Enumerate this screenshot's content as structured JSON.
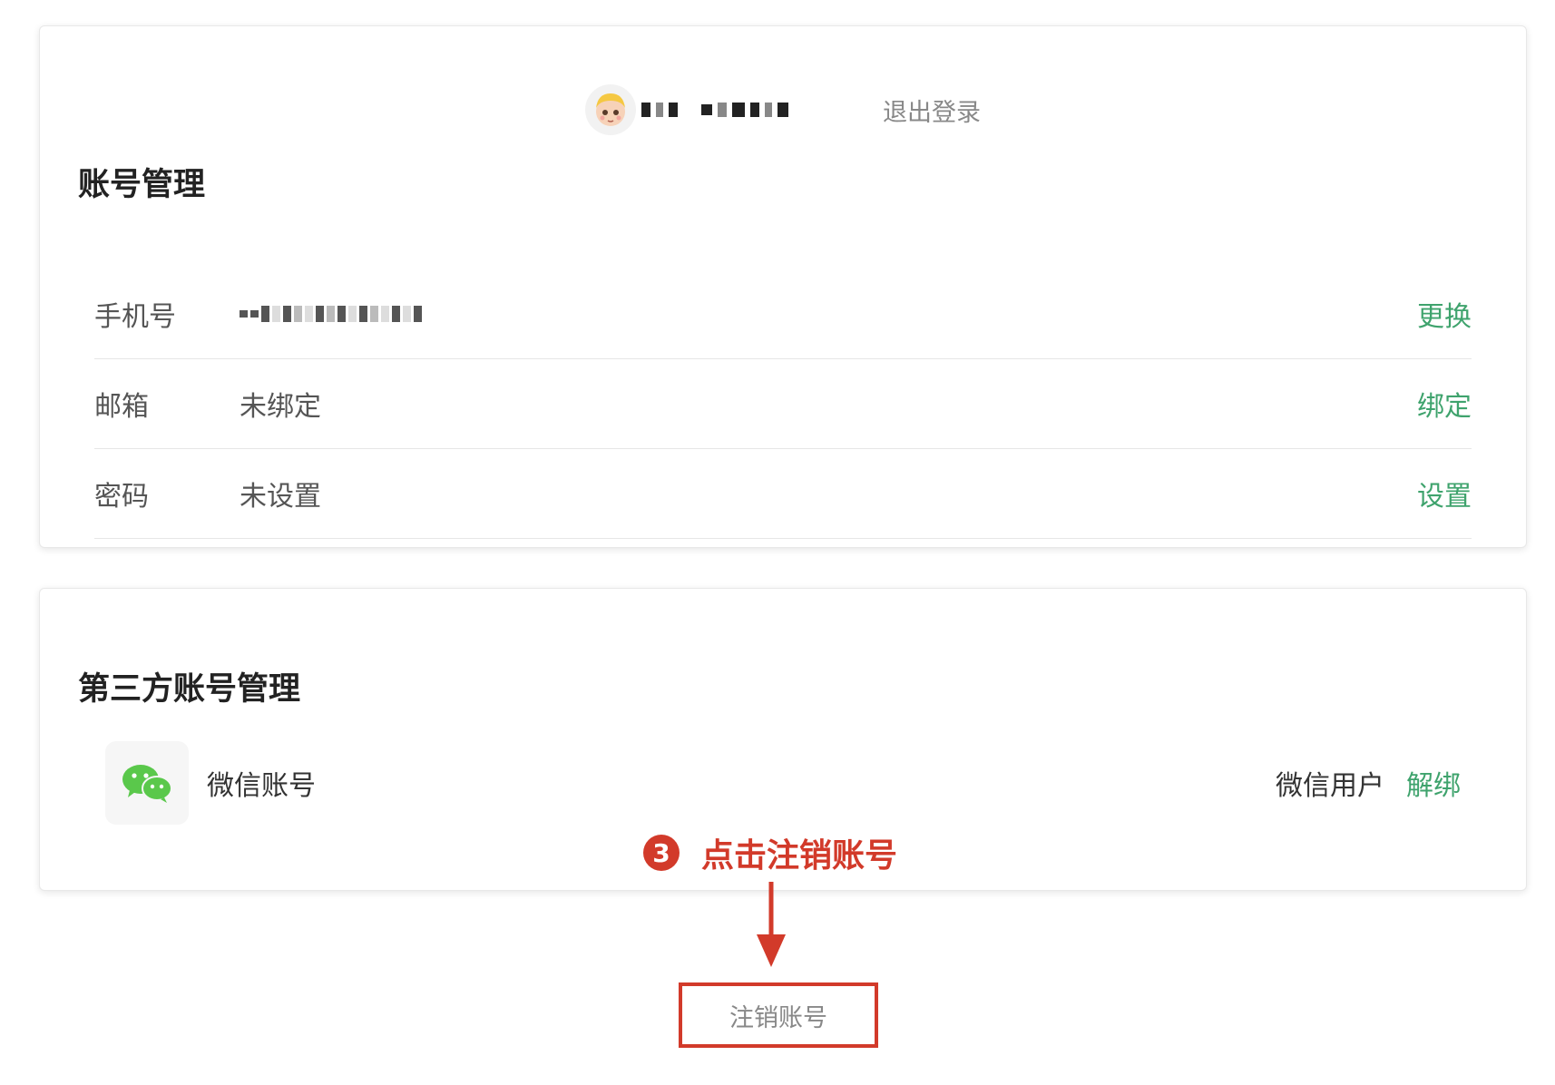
{
  "header": {
    "logout_label": "退出登录"
  },
  "account": {
    "title": "账号管理",
    "rows": [
      {
        "label": "手机号",
        "value": "",
        "action": "更换"
      },
      {
        "label": "邮箱",
        "value": "未绑定",
        "action": "绑定"
      },
      {
        "label": "密码",
        "value": "未设置",
        "action": "设置"
      }
    ]
  },
  "third_party": {
    "title": "第三方账号管理",
    "wechat": {
      "name": "微信账号",
      "user": "微信用户",
      "action": "解绑"
    }
  },
  "annotation": {
    "step": "3",
    "text": "点击注销账号"
  },
  "cancel_account": {
    "label": "注销账号"
  },
  "colors": {
    "accent_green": "#3fa36d",
    "annotation_red": "#d23a2a",
    "wechat_green": "#5ac84b"
  }
}
